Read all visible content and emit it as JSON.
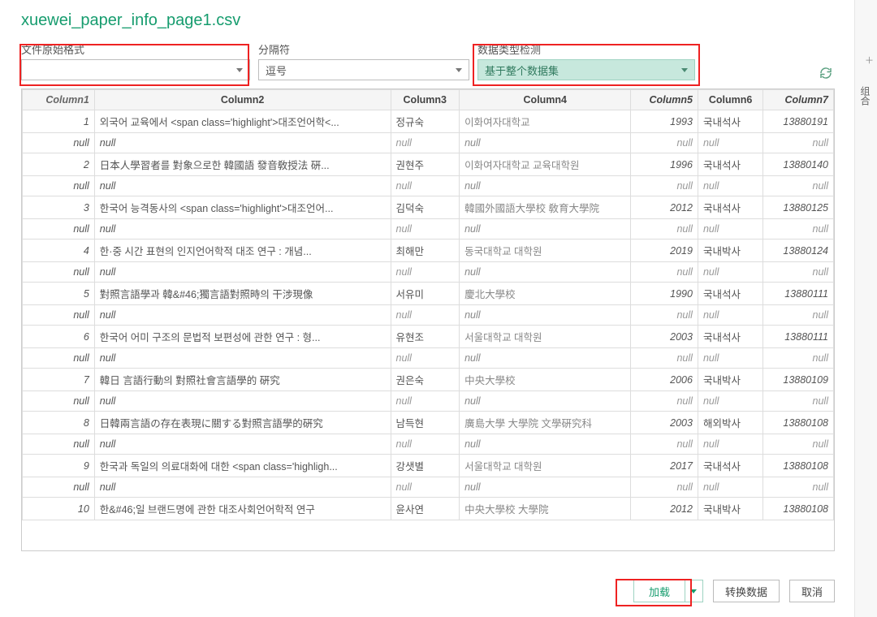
{
  "title": "xuewei_paper_info_page1.csv",
  "options": {
    "file_origin": {
      "label": "文件原始格式",
      "value": ""
    },
    "delimiter": {
      "label": "分隔符",
      "value": "逗号"
    },
    "datatype": {
      "label": "数据类型检测",
      "value": "基于整个数据集"
    }
  },
  "columns": [
    "Column1",
    "Column2",
    "Column3",
    "Column4",
    "Column5",
    "Column6",
    "Column7"
  ],
  "null_text": "null",
  "rows": [
    [
      "1",
      "외국어 교육에서 <span class='highlight'>대조언어학<...",
      "정규숙",
      "이화여자대학교",
      "1993",
      "국내석사",
      "13880191"
    ],
    [
      "null",
      "null",
      "null",
      "null",
      "null",
      "null",
      "null"
    ],
    [
      "2",
      "日本人學習者를 對象으로한 韓國語 發音敎授法 硏...",
      "권현주",
      "이화여자대학교 교육대학원",
      "1996",
      "국내석사",
      "13880140"
    ],
    [
      "null",
      "null",
      "null",
      "null",
      "null",
      "null",
      "null"
    ],
    [
      "3",
      "한국어 능격동사의 <span class='highlight'>대조언어...",
      "김덕숙",
      "韓國外國語大學校 敎育大學院",
      "2012",
      "국내석사",
      "13880125"
    ],
    [
      "null",
      "null",
      "null",
      "null",
      "null",
      "null",
      "null"
    ],
    [
      "4",
      "한·중 시간 표현의 인지언어학적 대조 연구 : 개념...",
      "최해만",
      "동국대학교 대학원",
      "2019",
      "국내박사",
      "13880124"
    ],
    [
      "null",
      "null",
      "null",
      "null",
      "null",
      "null",
      "null"
    ],
    [
      "5",
      "對照言語學과 韓&#46;獨言語對照時의 干涉現像",
      "서유미",
      "慶北大學校",
      "1990",
      "국내석사",
      "13880111"
    ],
    [
      "null",
      "null",
      "null",
      "null",
      "null",
      "null",
      "null"
    ],
    [
      "6",
      "한국어 어미 구조의 문법적 보편성에 관한 연구 : 형...",
      "유현조",
      "서울대학교 대학원",
      "2003",
      "국내석사",
      "13880111"
    ],
    [
      "null",
      "null",
      "null",
      "null",
      "null",
      "null",
      "null"
    ],
    [
      "7",
      "韓日 言語行動의 對照社會言語學的 硏究",
      "권은숙",
      "中央大學校",
      "2006",
      "국내박사",
      "13880109"
    ],
    [
      "null",
      "null",
      "null",
      "null",
      "null",
      "null",
      "null"
    ],
    [
      "8",
      "日韓兩言語の存在表現に關する對照言語學的硏究",
      "남득현",
      "廣島大學 大學院 文學硏究科",
      "2003",
      "해외박사",
      "13880108"
    ],
    [
      "null",
      "null",
      "null",
      "null",
      "null",
      "null",
      "null"
    ],
    [
      "9",
      "한국과 독일의 의료대화에 대한 <span class='highligh...",
      "강샛별",
      "서울대학교 대학원",
      "2017",
      "국내석사",
      "13880108"
    ],
    [
      "null",
      "null",
      "null",
      "null",
      "null",
      "null",
      "null"
    ],
    [
      "10",
      "한&#46;일 브랜드명에 관한 대조사회언어학적 연구",
      "윤사연",
      "中央大學校 大學院",
      "2012",
      "국내박사",
      "13880108"
    ]
  ],
  "buttons": {
    "load": "加载",
    "transform": "转换数据",
    "cancel": "取消"
  },
  "side": {
    "label": "组合"
  }
}
